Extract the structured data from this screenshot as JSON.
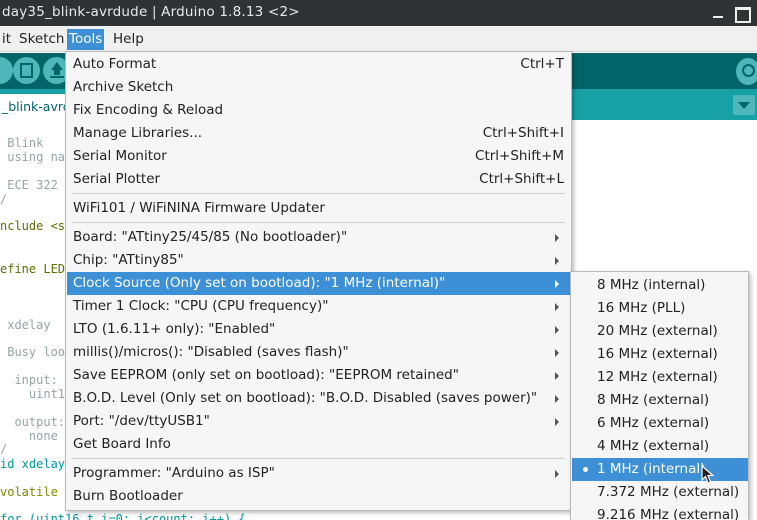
{
  "window": {
    "title": "day35_blink-avrdude | Arduino 1.8.13 <2>"
  },
  "menubar": {
    "items": [
      "it",
      "Sketch",
      "Tools",
      "Help"
    ]
  },
  "tab": {
    "label": "_blink-avrdude"
  },
  "editor": {
    "lines": [
      " Blink",
      " using nat",
      "",
      " ECE 322 c",
      "/",
      "nclude <st",
      "",
      "efine LED_",
      "",
      "",
      " xdelay",
      "",
      " Busy loop",
      "",
      "  input:",
      "    uint16",
      "",
      "  output:",
      "    none",
      "/",
      "id xdelay(",
      "",
      "volatile u",
      "",
      "for (uint16_t i=0; i<count; i++) {"
    ]
  },
  "tools_menu": {
    "items": [
      {
        "label": "Auto Format",
        "shortcut": "Ctrl+T"
      },
      {
        "label": "Archive Sketch",
        "shortcut": ""
      },
      {
        "label": "Fix Encoding & Reload",
        "shortcut": ""
      },
      {
        "label": "Manage Libraries...",
        "shortcut": "Ctrl+Shift+I"
      },
      {
        "label": "Serial Monitor",
        "shortcut": "Ctrl+Shift+M"
      },
      {
        "label": "Serial Plotter",
        "shortcut": "Ctrl+Shift+L"
      },
      {
        "label": "WiFi101 / WiFiNINA Firmware Updater",
        "shortcut": ""
      },
      {
        "label": "Board: \"ATtiny25/45/85 (No bootloader)\"",
        "shortcut": ""
      },
      {
        "label": "Chip: \"ATtiny85\"",
        "shortcut": ""
      },
      {
        "label": "Clock Source (Only set on bootload): \"1 MHz (internal)\"",
        "shortcut": ""
      },
      {
        "label": "Timer 1 Clock: \"CPU (CPU frequency)\"",
        "shortcut": ""
      },
      {
        "label": "LTO (1.6.11+ only): \"Enabled\"",
        "shortcut": ""
      },
      {
        "label": "millis()/micros(): \"Disabled (saves flash)\"",
        "shortcut": ""
      },
      {
        "label": "Save EEPROM (only set on bootload): \"EEPROM retained\"",
        "shortcut": ""
      },
      {
        "label": "B.O.D. Level (Only set on bootload): \"B.O.D. Disabled (saves power)\"",
        "shortcut": ""
      },
      {
        "label": "Port: \"/dev/ttyUSB1\"",
        "shortcut": ""
      },
      {
        "label": "Get Board Info",
        "shortcut": ""
      },
      {
        "label": "Programmer: \"Arduino as ISP\"",
        "shortcut": ""
      },
      {
        "label": "Burn Bootloader",
        "shortcut": ""
      }
    ]
  },
  "clock_submenu": {
    "selected": "1 MHz (internal)",
    "items": [
      "8 MHz (internal)",
      "16 MHz (PLL)",
      "20 MHz (external)",
      "16 MHz (external)",
      "12 MHz (external)",
      "8 MHz (external)",
      "6 MHz (external)",
      "4 MHz (external)",
      "1 MHz (internal)",
      "7.372 MHz (external)",
      "9.216 MHz (external)"
    ]
  },
  "colors": {
    "accent": "#3d8fd6",
    "toolbar": "#006468",
    "tabbar": "#17a1a5",
    "titlebar": "#2f3336"
  }
}
